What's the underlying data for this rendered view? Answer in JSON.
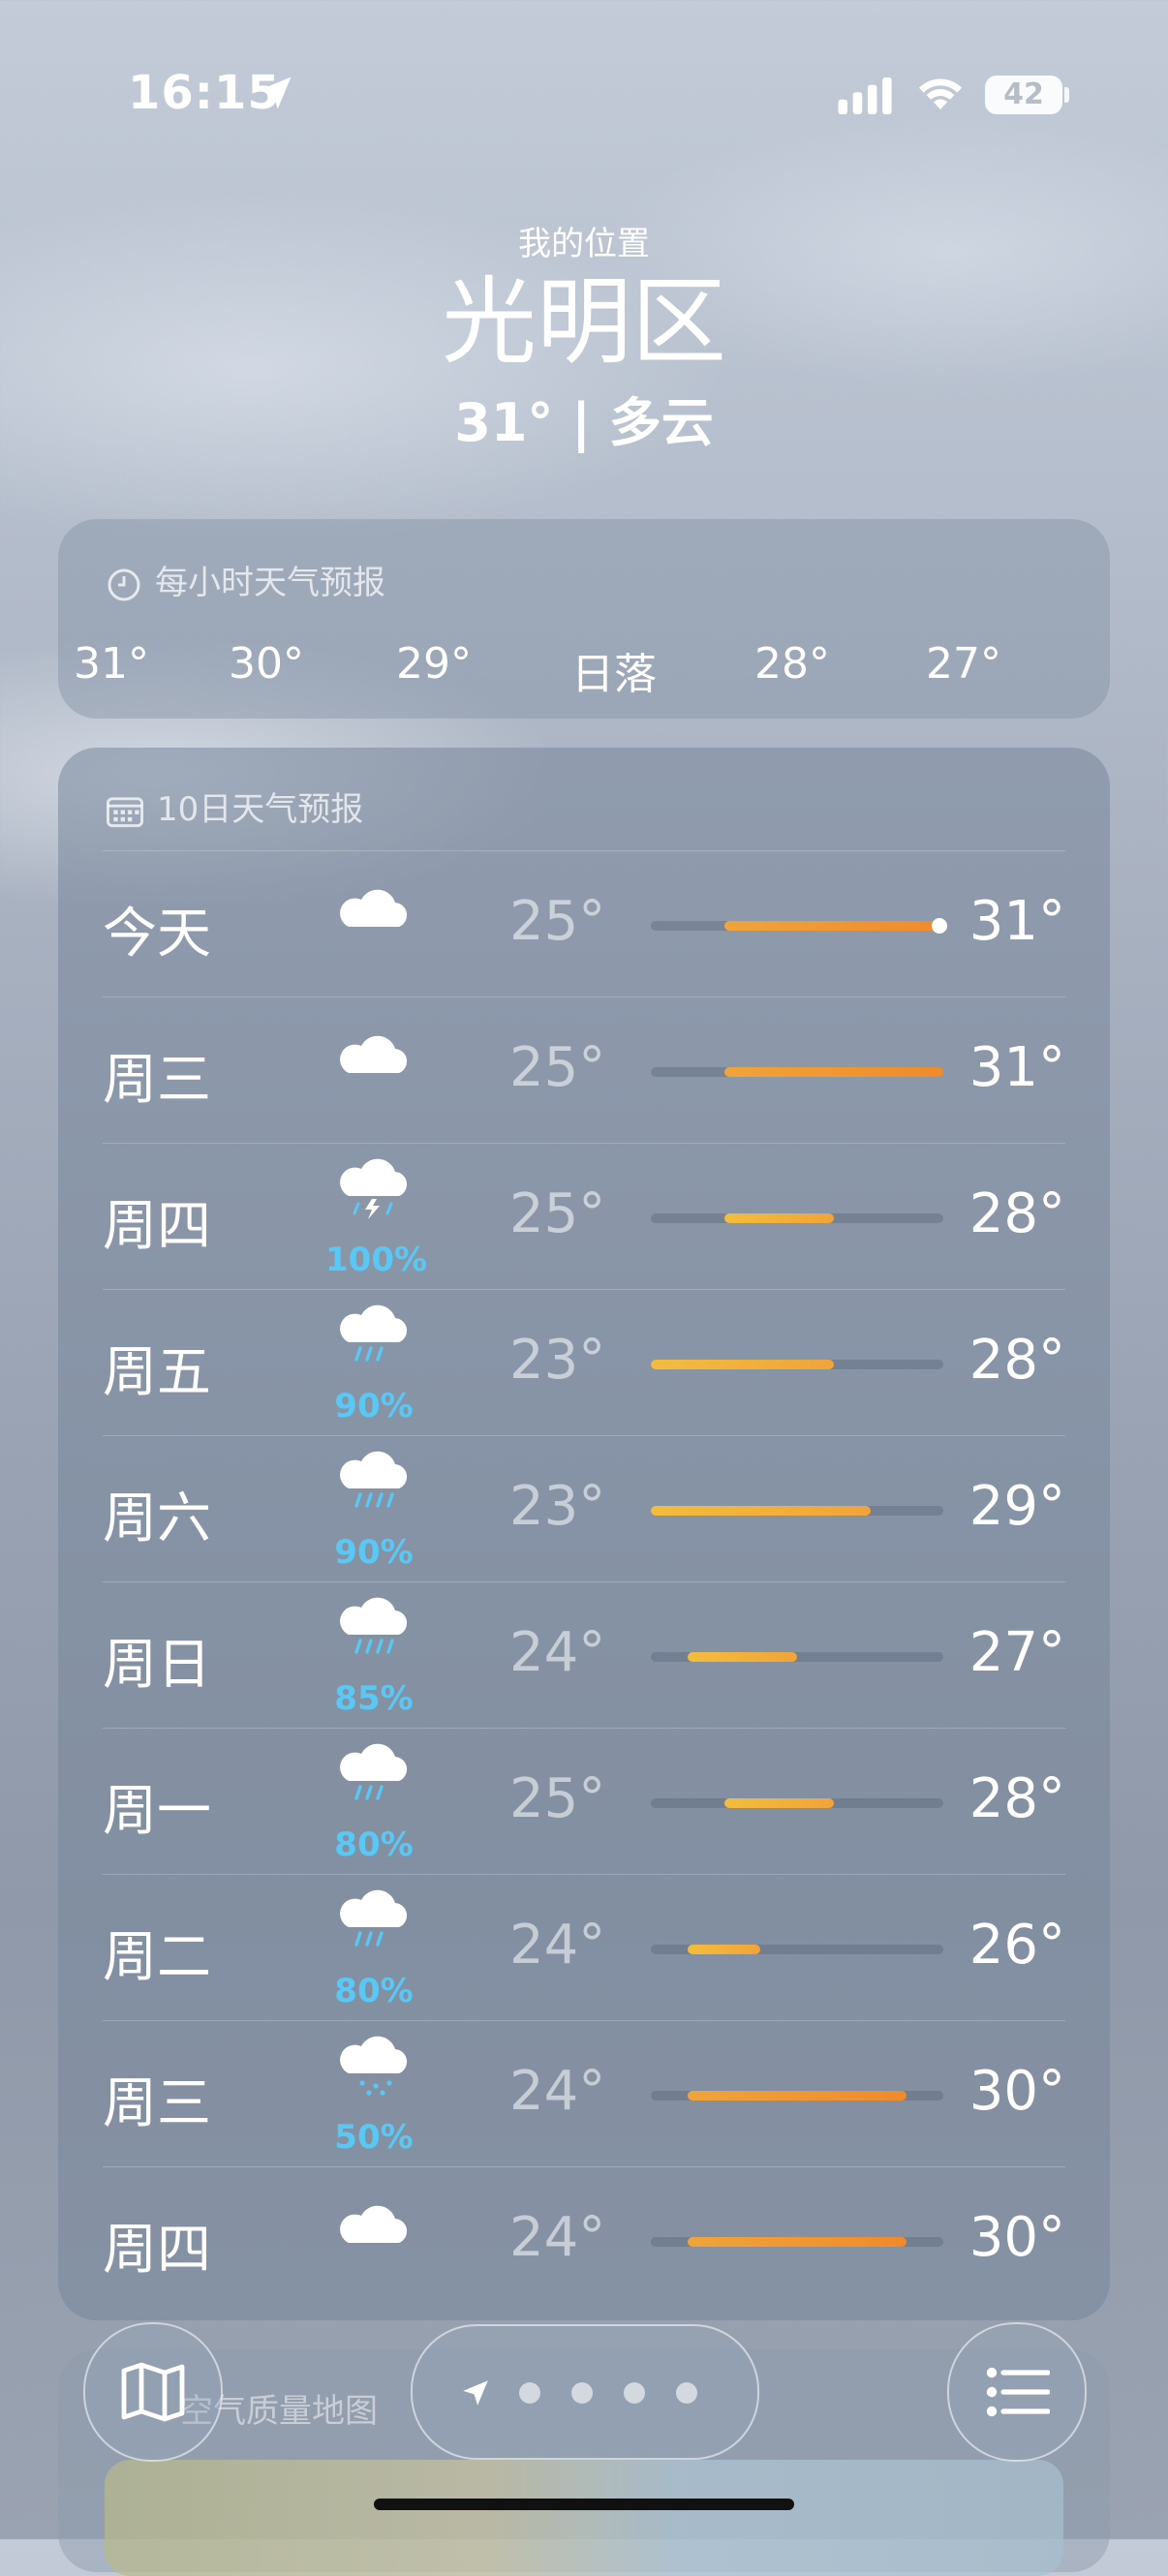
{
  "status_bar": {
    "time": "16:15",
    "battery": "42"
  },
  "header": {
    "my_location": "我的位置",
    "city": "光明区",
    "condition_line": "31° | 多云"
  },
  "hourly": {
    "title": "每小时天气预报",
    "items": [
      "31°",
      "30°",
      "29°",
      "日落",
      "28°",
      "27°"
    ]
  },
  "daily": {
    "title": "10日天气预报",
    "range_min": 23,
    "range_max": 31,
    "current_temp": 31,
    "days": [
      {
        "label": "今天",
        "icon": "cloud-icon",
        "precip": "",
        "low": "25°",
        "high": "31°",
        "low_v": 25,
        "high_v": 31
      },
      {
        "label": "周三",
        "icon": "cloud-icon",
        "precip": "",
        "low": "25°",
        "high": "31°",
        "low_v": 25,
        "high_v": 31
      },
      {
        "label": "周四",
        "icon": "thunderstorm-icon",
        "precip": "100%",
        "low": "25°",
        "high": "28°",
        "low_v": 25,
        "high_v": 28
      },
      {
        "label": "周五",
        "icon": "rain-icon",
        "precip": "90%",
        "low": "23°",
        "high": "28°",
        "low_v": 23,
        "high_v": 28
      },
      {
        "label": "周六",
        "icon": "heavy-rain-icon",
        "precip": "90%",
        "low": "23°",
        "high": "29°",
        "low_v": 23,
        "high_v": 29
      },
      {
        "label": "周日",
        "icon": "heavy-rain-icon",
        "precip": "85%",
        "low": "24°",
        "high": "27°",
        "low_v": 24,
        "high_v": 27
      },
      {
        "label": "周一",
        "icon": "rain-icon",
        "precip": "80%",
        "low": "25°",
        "high": "28°",
        "low_v": 25,
        "high_v": 28
      },
      {
        "label": "周二",
        "icon": "rain-icon",
        "precip": "80%",
        "low": "24°",
        "high": "26°",
        "low_v": 24,
        "high_v": 26
      },
      {
        "label": "周三",
        "icon": "drizzle-icon",
        "precip": "50%",
        "low": "24°",
        "high": "30°",
        "low_v": 24,
        "high_v": 30
      },
      {
        "label": "周四",
        "icon": "cloud-icon",
        "precip": "",
        "low": "24°",
        "high": "30°",
        "low_v": 24,
        "high_v": 30
      }
    ]
  },
  "air_quality": {
    "title": "空气质量地图"
  },
  "colors": {
    "precip": "#59c8f5",
    "bar_warm": "#f0a43a",
    "bar_hot": "#f08a2a"
  }
}
